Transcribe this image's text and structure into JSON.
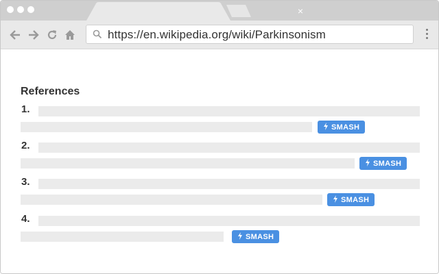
{
  "browser": {
    "tab_close_glyph": "×",
    "address_url": "https://en.wikipedia.org/wiki/Parkinsonism",
    "icons": [
      "back-arrow-icon",
      "forward-arrow-icon",
      "reload-icon",
      "home-icon",
      "search-icon",
      "menu-kebab-icon",
      "close-icon"
    ]
  },
  "page": {
    "heading": "References",
    "references": [
      {
        "number": "1.",
        "button_label": "SMASH"
      },
      {
        "number": "2.",
        "button_label": "SMASH"
      },
      {
        "number": "3.",
        "button_label": "SMASH"
      },
      {
        "number": "4.",
        "button_label": "SMASH"
      }
    ]
  },
  "colors": {
    "accent_button": "#4a90e2",
    "chrome_bar": "#cfcfcf",
    "toolbar": "#e9e9e9",
    "placeholder_line": "#ebebeb"
  }
}
